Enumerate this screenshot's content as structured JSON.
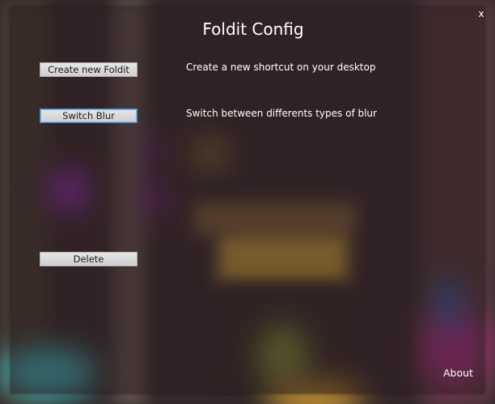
{
  "window": {
    "title": "Foldit Config",
    "close_label": "x"
  },
  "actions": [
    {
      "button_label": "Create new Foldit",
      "description": "Create a new shortcut on your desktop"
    },
    {
      "button_label": "Switch Blur",
      "description": "Switch between differents types of blur"
    },
    {
      "button_label": "Delete",
      "description": ""
    }
  ],
  "footer": {
    "about_label": "About"
  },
  "colors": {
    "background_accent_purple": "#b030e0",
    "background_accent_yellow": "#e8c040",
    "background_accent_cyan": "#40c8d0",
    "button_focus_border": "#3c8fd6"
  }
}
